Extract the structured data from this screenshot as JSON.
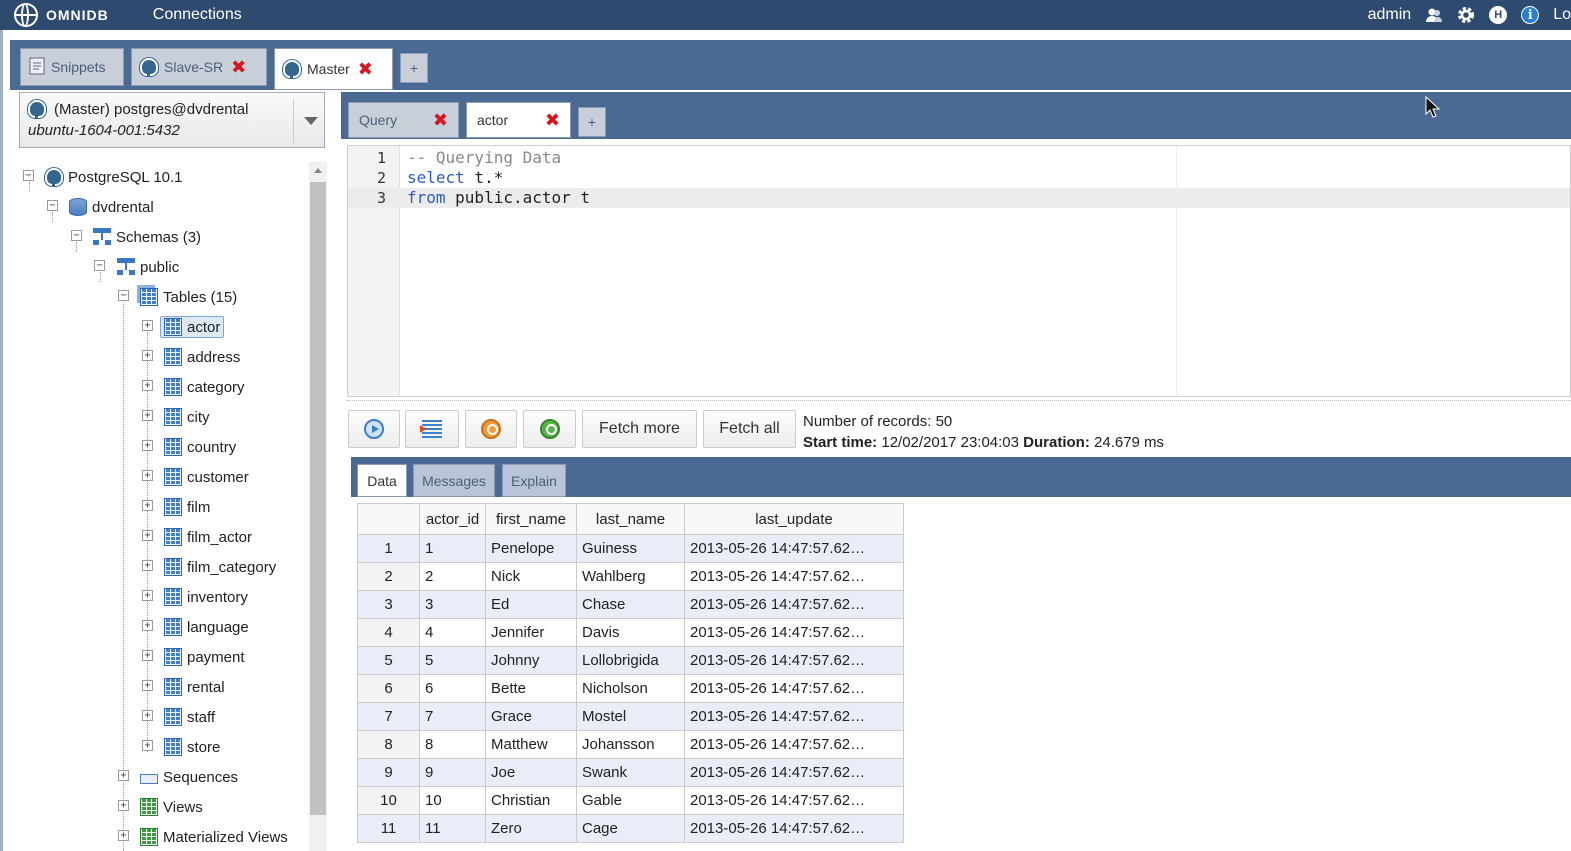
{
  "topbar": {
    "brand": "OMNIDB",
    "connections_label": "Connections",
    "user": "admin",
    "help_letter": "H",
    "info_letter": "i",
    "trailing_text": "Lo"
  },
  "outer_tabs": [
    {
      "label": "Snippets"
    },
    {
      "label": "Slave-SR"
    },
    {
      "label": "Master"
    }
  ],
  "plus_label": "+",
  "connection": {
    "line1": "(Master) postgres@dvdrental",
    "line2": "ubuntu-1604-001:5432"
  },
  "tree": {
    "server": "PostgreSQL 10.1",
    "database": "dvdrental",
    "schemas": "Schemas (3)",
    "schema": "public",
    "tables_group": "Tables (15)",
    "tables": [
      "actor",
      "address",
      "category",
      "city",
      "country",
      "customer",
      "film",
      "film_actor",
      "film_category",
      "inventory",
      "language",
      "payment",
      "rental",
      "staff",
      "store"
    ],
    "sequences": "Sequences",
    "views": "Views",
    "mat_views": "Materialized Views"
  },
  "inner_tabs": [
    {
      "label": "Query"
    },
    {
      "label": "actor"
    }
  ],
  "editor": {
    "line_numbers": [
      "1",
      "2",
      "3"
    ],
    "line1_comment": "-- Querying Data",
    "line2_kw": "select",
    "line2_rest": " t.*",
    "line3_kw": "from",
    "line3_rest": " public.actor t"
  },
  "toolbar": {
    "fetch_more": "Fetch more",
    "fetch_all": "Fetch all",
    "records_label": "Number of records:",
    "records_value": "50",
    "start_label": "Start time:",
    "start_value": "12/02/2017 23:04:03",
    "duration_label": "Duration:",
    "duration_value": "24.679 ms"
  },
  "result_tabs": [
    {
      "label": "Data"
    },
    {
      "label": "Messages"
    },
    {
      "label": "Explain"
    }
  ],
  "grid": {
    "columns": [
      "",
      "actor_id",
      "first_name",
      "last_name",
      "last_update"
    ],
    "rows": [
      [
        "1",
        "1",
        "Penelope",
        "Guiness",
        "2013-05-26 14:47:57.62…"
      ],
      [
        "2",
        "2",
        "Nick",
        "Wahlberg",
        "2013-05-26 14:47:57.62…"
      ],
      [
        "3",
        "3",
        "Ed",
        "Chase",
        "2013-05-26 14:47:57.62…"
      ],
      [
        "4",
        "4",
        "Jennifer",
        "Davis",
        "2013-05-26 14:47:57.62…"
      ],
      [
        "5",
        "5",
        "Johnny",
        "Lollobrigida",
        "2013-05-26 14:47:57.62…"
      ],
      [
        "6",
        "6",
        "Bette",
        "Nicholson",
        "2013-05-26 14:47:57.62…"
      ],
      [
        "7",
        "7",
        "Grace",
        "Mostel",
        "2013-05-26 14:47:57.62…"
      ],
      [
        "8",
        "8",
        "Matthew",
        "Johansson",
        "2013-05-26 14:47:57.62…"
      ],
      [
        "9",
        "9",
        "Joe",
        "Swank",
        "2013-05-26 14:47:57.62…"
      ],
      [
        "10",
        "10",
        "Christian",
        "Gable",
        "2013-05-26 14:47:57.62…"
      ],
      [
        "11",
        "11",
        "Zero",
        "Cage",
        "2013-05-26 14:47:57.62…"
      ]
    ]
  }
}
